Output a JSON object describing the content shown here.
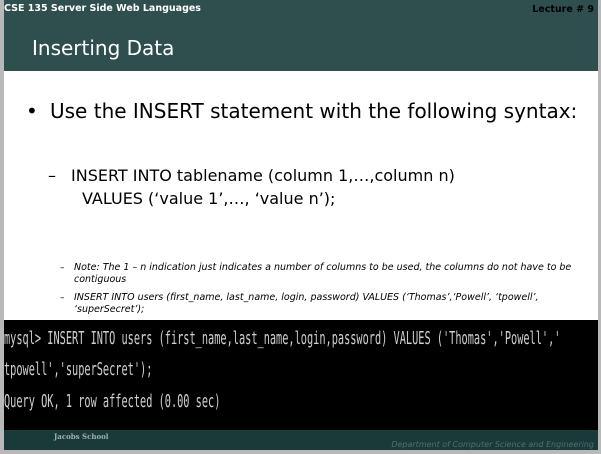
{
  "header": {
    "course": "CSE 135   Server Side Web Languages",
    "lecture": "Lecture # 9"
  },
  "slide": {
    "title": "Inserting Data",
    "bullet": "Use the INSERT statement with the following syntax:",
    "syntax_line1": "INSERT INTO tablename (column 1,…,column n)",
    "syntax_line2": "VALUES (‘value 1’,…, ‘value n’);",
    "note1": "Note: The 1 – n indication just indicates a number of columns to be used, the columns do not have to be contiguous",
    "note2": "INSERT INTO users (first_name, last_name, login, password) VALUES (‘Thomas’,‘Powell’, ‘tpowell’, ‘superSecret’);"
  },
  "terminal": {
    "line1": "mysql> INSERT INTO users (first_name,last_name,login,password) VALUES ('Thomas','Powell','",
    "line2": "tpowell','superSecret');",
    "line3": "Query OK, 1 row affected (0.00 sec)"
  },
  "footer": {
    "school": "Jacobs School",
    "department": "Department of Computer Science and Engineering"
  },
  "colors": {
    "header_bg": "#2f4f4f",
    "terminal_bg": "#000000",
    "terminal_text": "#d0d0d0"
  }
}
